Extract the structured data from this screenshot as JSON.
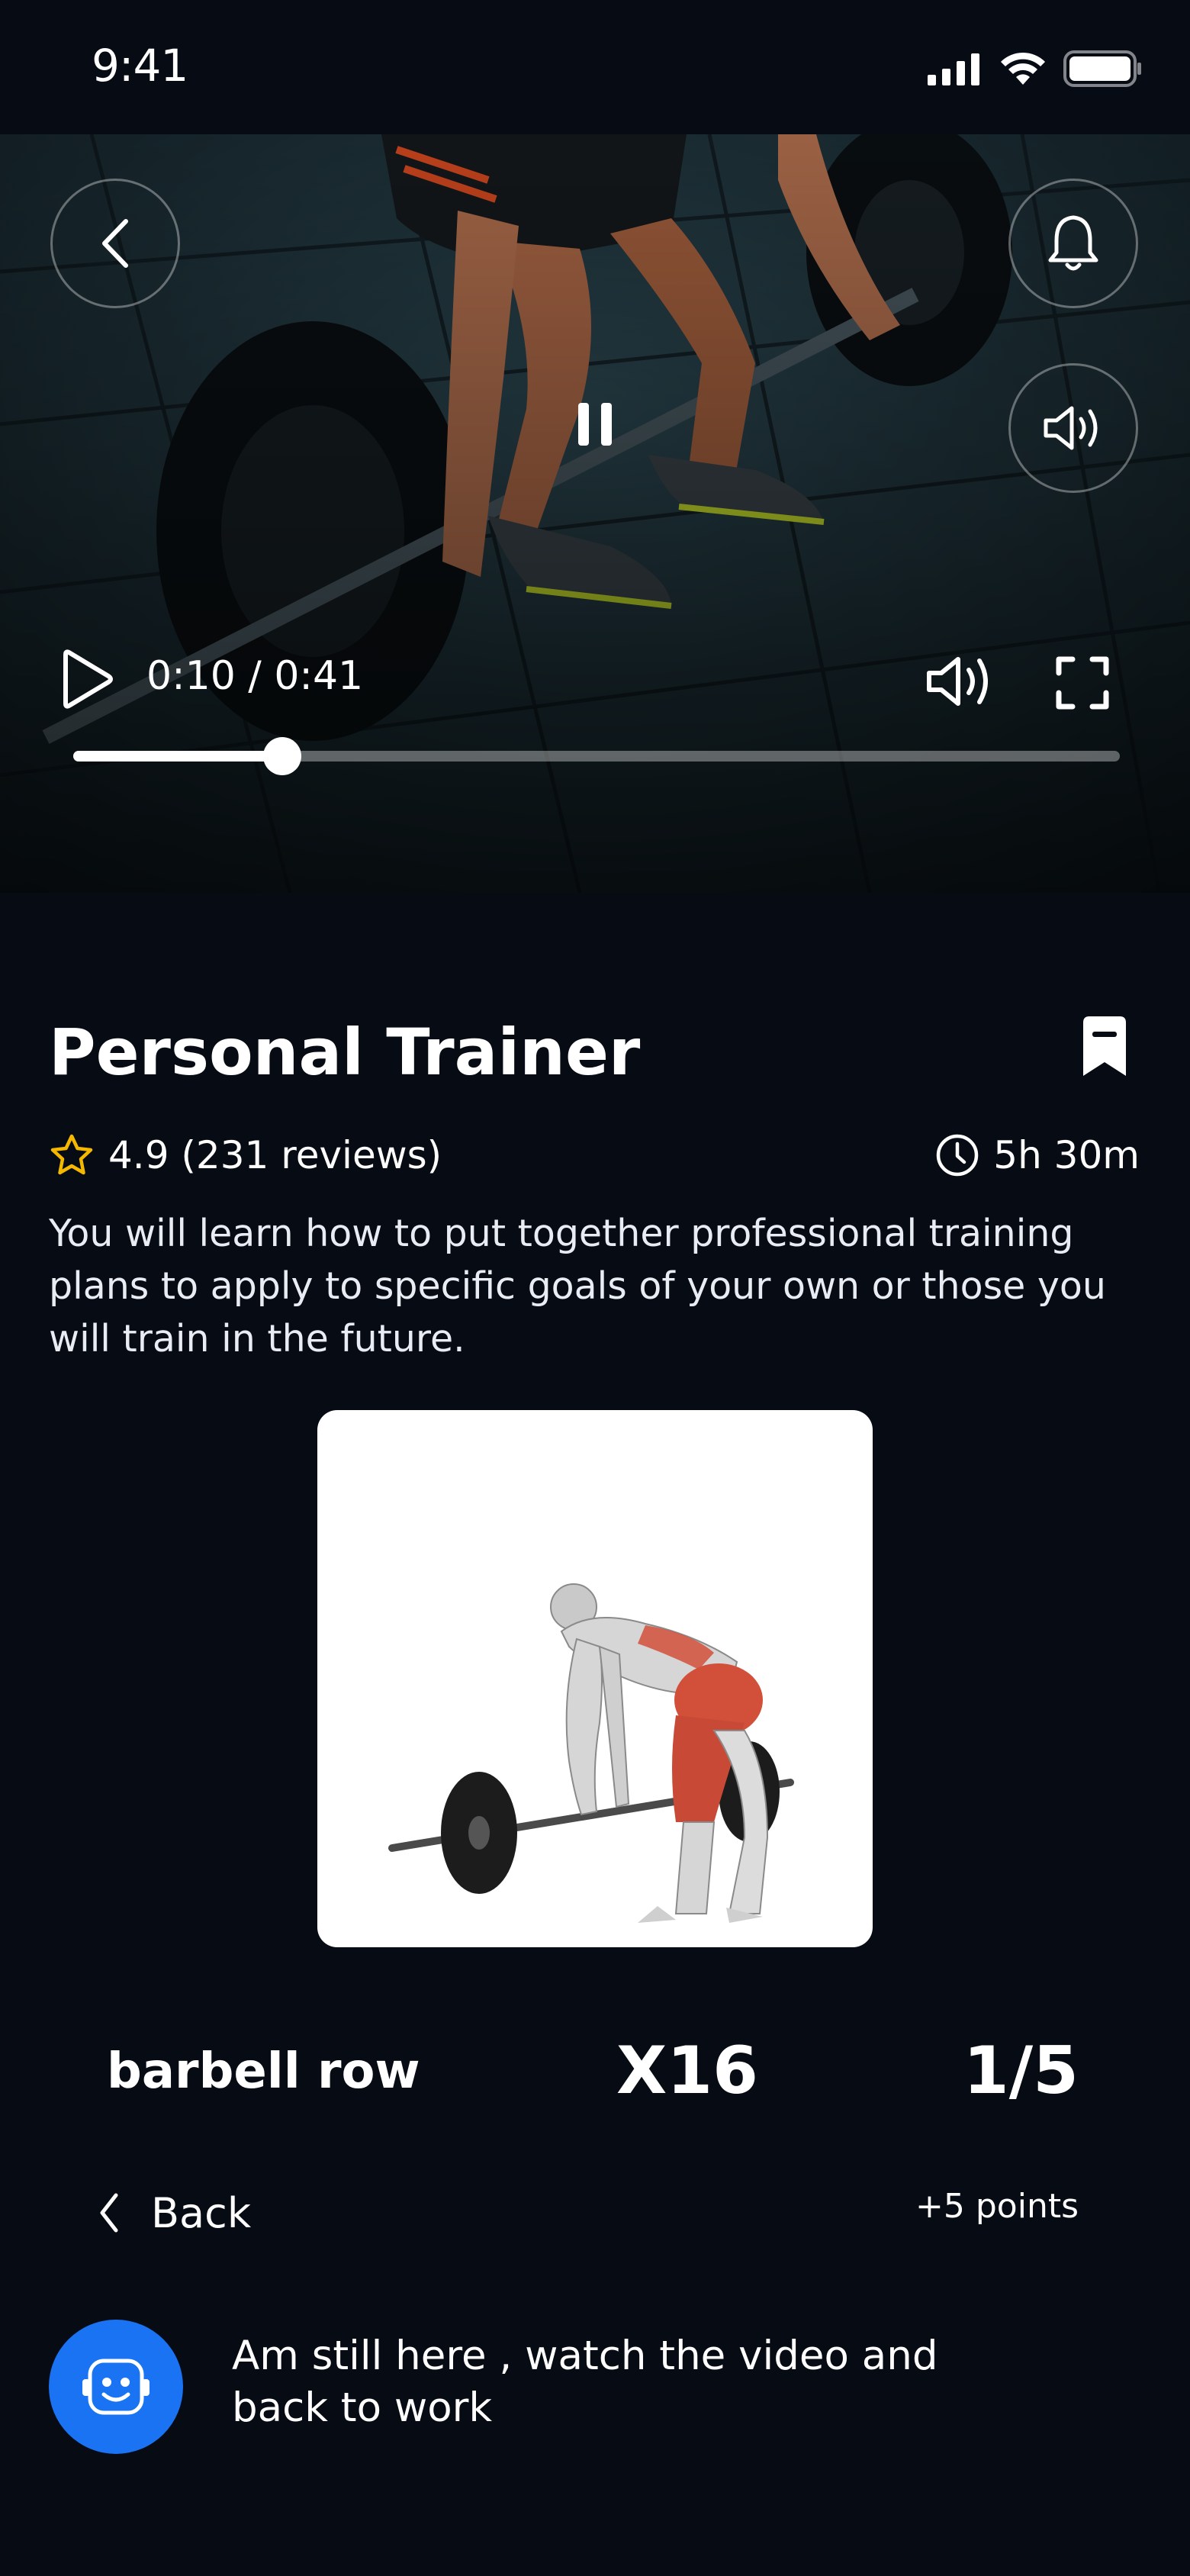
{
  "status_bar": {
    "time": "9:41",
    "icons": [
      "signal-icon",
      "wifi-icon",
      "battery-icon"
    ]
  },
  "video": {
    "current_time": "0:10",
    "duration": "0:41",
    "time_display": "0:10 / 0:41",
    "progress_fraction": 0.2,
    "state": "playing",
    "icons": [
      "back-icon",
      "bell-icon",
      "speaker-icon",
      "pause-icon",
      "play-icon",
      "volume-icon",
      "fullscreen-icon"
    ]
  },
  "course": {
    "title": "Personal Trainer",
    "rating_text": "4.9 (231 reviews)",
    "rating": 4.9,
    "reviews": 231,
    "duration": "5h 30m",
    "description": "You will learn how to put together professional training plans to apply to specific goals of your own or those you will train in the future."
  },
  "exercise": {
    "name": "barbell row",
    "reps": "X16",
    "set": "1/5"
  },
  "navigation": {
    "back_label": "Back",
    "points": "+5 points"
  },
  "assistant": {
    "message": "Am still here , watch the video  and back to work"
  },
  "colors": {
    "background": "#060b14",
    "accent": "#1a73f2",
    "star": "#f5b800",
    "muscle_highlight": "#d2503a"
  }
}
